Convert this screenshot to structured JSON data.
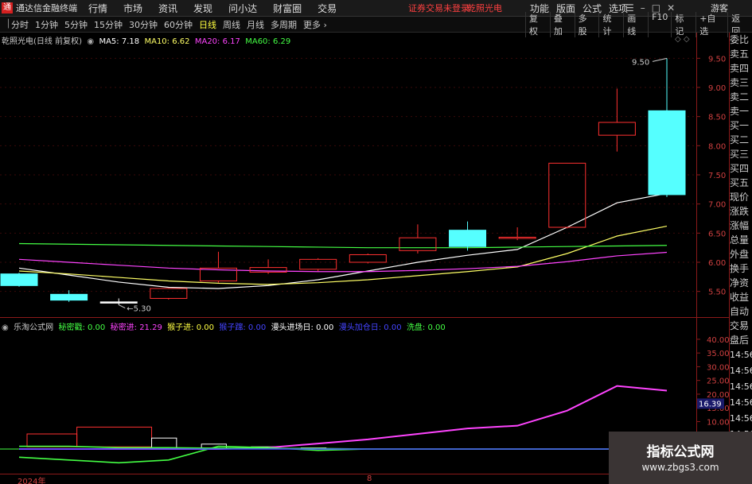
{
  "menubar": {
    "app_title": "通达信金融终端",
    "items": [
      "行情",
      "市场",
      "资讯",
      "发现",
      "问小达",
      "财富圈",
      "交易"
    ],
    "notice": "证券交易未登录",
    "stock_name": "乾照光电",
    "right_items": [
      "功能",
      "版面",
      "公式",
      "选项"
    ],
    "guest": "游客"
  },
  "toolbar": {
    "periods": [
      "分时",
      "1分钟",
      "5分钟",
      "15分钟",
      "30分钟",
      "60分钟",
      "日线",
      "周线",
      "月线",
      "多周期",
      "更多"
    ],
    "active_period": "日线",
    "right_items": [
      "复权",
      "叠加",
      "多股",
      "统计",
      "画线",
      "F10",
      "标记",
      "+自选",
      "返回"
    ]
  },
  "main_legend": {
    "title": "乾照光电(日线 前复权)",
    "ma5": "MA5: 7.18",
    "ma10": "MA10: 6.62",
    "ma20": "MA20: 6.17",
    "ma60": "MA60: 6.29",
    "colors": {
      "title": "#c8c8c8",
      "ma5": "#ffffff",
      "ma10": "#ffff66",
      "ma20": "#ff44ff",
      "ma60": "#44ff44"
    }
  },
  "sub_legend": {
    "title": "乐淘公式网",
    "items": [
      {
        "text": "秘密戳: 0.00",
        "color": "#44ff44"
      },
      {
        "text": "秘密进: 21.29",
        "color": "#ff44ff"
      },
      {
        "text": "猴子进: 0.00",
        "color": "#ffff44"
      },
      {
        "text": "猴子蹿: 0.00",
        "color": "#4444ff"
      },
      {
        "text": "漫头进场日: 0.00",
        "color": "#ffffff"
      },
      {
        "text": "漫头加仓日: 0.00",
        "color": "#4444ff"
      },
      {
        "text": "洗盘: 0.00",
        "color": "#44ff44"
      }
    ]
  },
  "main_axis_ticks": [
    "9.50",
    "9.00",
    "8.50",
    "8.00",
    "7.50",
    "7.00",
    "6.50",
    "6.00",
    "5.50"
  ],
  "sub_axis_ticks": [
    "40.00",
    "35.00",
    "30.00",
    "25.00",
    "20.00",
    "15.00",
    "10.00",
    "5.00"
  ],
  "sub_current_value": "16.39",
  "annotations": {
    "high_label": "9.50",
    "low_label": "5.30"
  },
  "bottom_axis": {
    "left_label": "2024年",
    "mid_label": "8"
  },
  "right_panel": {
    "items": [
      "委比",
      "卖五",
      "卖四",
      "卖三",
      "卖二",
      "卖一",
      "买一",
      "买二",
      "买三",
      "买四",
      "买五",
      "现价",
      "涨跌",
      "涨幅",
      "总量",
      "外盘",
      "换手",
      "净资",
      "收益"
    ],
    "bottom_items": [
      "自动",
      "交易",
      "盘后"
    ],
    "times": [
      "14:56",
      "14:56",
      "14:56",
      "14:56",
      "14:56",
      "14:56"
    ]
  },
  "watermark": {
    "title": "指标公式网",
    "url": "www.zbgs3.com"
  },
  "chart_data": [
    {
      "type": "candlestick",
      "title": "乾照光电(日线 前复权)",
      "ylim": [
        5.25,
        9.75
      ],
      "candles": [
        {
          "open": 5.8,
          "close": 5.6,
          "high": 5.82,
          "low": 5.58,
          "color": "#55ffff"
        },
        {
          "open": 5.45,
          "close": 5.35,
          "high": 5.52,
          "low": 5.32,
          "color": "#55ffff"
        },
        {
          "open": 5.32,
          "close": 5.3,
          "high": 5.38,
          "low": 5.27,
          "color": "#ffffff"
        },
        {
          "open": 5.38,
          "close": 5.55,
          "high": 5.56,
          "low": 5.36,
          "color": "#ff3030"
        },
        {
          "open": 5.68,
          "close": 5.9,
          "high": 6.18,
          "low": 5.65,
          "color": "#ff3030"
        },
        {
          "open": 5.83,
          "close": 5.91,
          "high": 6.05,
          "low": 5.8,
          "color": "#ff3030"
        },
        {
          "open": 5.88,
          "close": 6.05,
          "high": 6.07,
          "low": 5.85,
          "color": "#ff3030"
        },
        {
          "open": 6.0,
          "close": 6.13,
          "high": 6.15,
          "low": 5.98,
          "color": "#ff3030"
        },
        {
          "open": 6.2,
          "close": 6.42,
          "high": 6.65,
          "low": 6.15,
          "color": "#ff3030"
        },
        {
          "open": 6.55,
          "close": 6.27,
          "high": 6.7,
          "low": 6.2,
          "color": "#55ffff"
        },
        {
          "open": 6.43,
          "close": 6.41,
          "high": 6.6,
          "low": 6.38,
          "color": "#ff3030"
        },
        {
          "open": 6.6,
          "close": 7.7,
          "high": 7.7,
          "low": 6.58,
          "color": "#ff3030"
        },
        {
          "open": 8.18,
          "close": 8.4,
          "high": 8.98,
          "low": 7.9,
          "color": "#ff3030"
        },
        {
          "open": 8.6,
          "close": 7.16,
          "high": 9.5,
          "low": 7.12,
          "color": "#55ffff"
        }
      ],
      "series": [
        {
          "name": "MA5",
          "color": "#ffffff",
          "values": [
            5.9,
            5.78,
            5.66,
            5.57,
            5.55,
            5.6,
            5.7,
            5.85,
            6.0,
            6.12,
            6.22,
            6.6,
            7.02,
            7.18
          ]
        },
        {
          "name": "MA10",
          "color": "#ffff66",
          "values": [
            5.85,
            5.8,
            5.74,
            5.68,
            5.64,
            5.62,
            5.65,
            5.7,
            5.77,
            5.84,
            5.92,
            6.15,
            6.45,
            6.62
          ]
        },
        {
          "name": "MA20",
          "color": "#ff44ff",
          "values": [
            6.05,
            6.0,
            5.95,
            5.9,
            5.87,
            5.85,
            5.84,
            5.84,
            5.86,
            5.89,
            5.93,
            6.01,
            6.11,
            6.17
          ]
        },
        {
          "name": "MA60",
          "color": "#44ff44",
          "values": [
            6.32,
            6.31,
            6.3,
            6.29,
            6.28,
            6.27,
            6.26,
            6.25,
            6.25,
            6.25,
            6.26,
            6.27,
            6.28,
            6.29
          ]
        }
      ]
    },
    {
      "type": "line",
      "title": "乐淘公式网",
      "ylim": [
        0,
        42
      ],
      "x_points": [
        0,
        1,
        2,
        3,
        4,
        5,
        6,
        7,
        8,
        9,
        10,
        11,
        12,
        13
      ],
      "bars": [
        {
          "from": 0.5,
          "to": 1.5,
          "top": 5.5,
          "bottom": 0.8,
          "color": "#ff3030"
        },
        {
          "from": 1.5,
          "to": 3.0,
          "top": 8.0,
          "bottom": 0.8,
          "color": "#ff3030"
        },
        {
          "from": 3.0,
          "to": 3.5,
          "top": 4.0,
          "bottom": 0.0,
          "color": "#ffffff"
        },
        {
          "from": 4.0,
          "to": 4.5,
          "top": 1.8,
          "bottom": 0.0,
          "color": "#ffffff"
        },
        {
          "from": 5.0,
          "to": 5.5,
          "top": 0.8,
          "bottom": 0.0,
          "color": "#ffffff"
        },
        {
          "from": 6.0,
          "to": 6.5,
          "top": 0.4,
          "bottom": 0.0,
          "color": "#ffffff"
        }
      ],
      "series": [
        {
          "name": "秘密进",
          "color": "#ff44ff",
          "values": [
            0,
            0,
            0,
            0,
            0,
            0.5,
            2,
            3.5,
            5.5,
            7.5,
            8.5,
            14,
            23,
            21.29
          ]
        },
        {
          "name": "秘密戳",
          "color": "#44ff44",
          "values": [
            -3,
            -4,
            -5,
            -4,
            1,
            0.5,
            -0.5,
            0,
            0,
            0,
            0,
            0,
            0,
            0
          ]
        },
        {
          "name": "洗盘",
          "color": "#44ff44",
          "values": [
            1,
            1,
            0.5,
            0.5,
            0.3,
            0.2,
            0.2,
            0,
            0,
            0,
            0,
            0,
            0,
            0
          ]
        },
        {
          "name": "猴子蹿",
          "color": "#4444ff",
          "values": [
            0,
            0,
            0,
            0,
            0,
            0,
            0,
            0,
            0,
            0,
            0,
            0,
            0,
            0
          ]
        }
      ]
    }
  ]
}
